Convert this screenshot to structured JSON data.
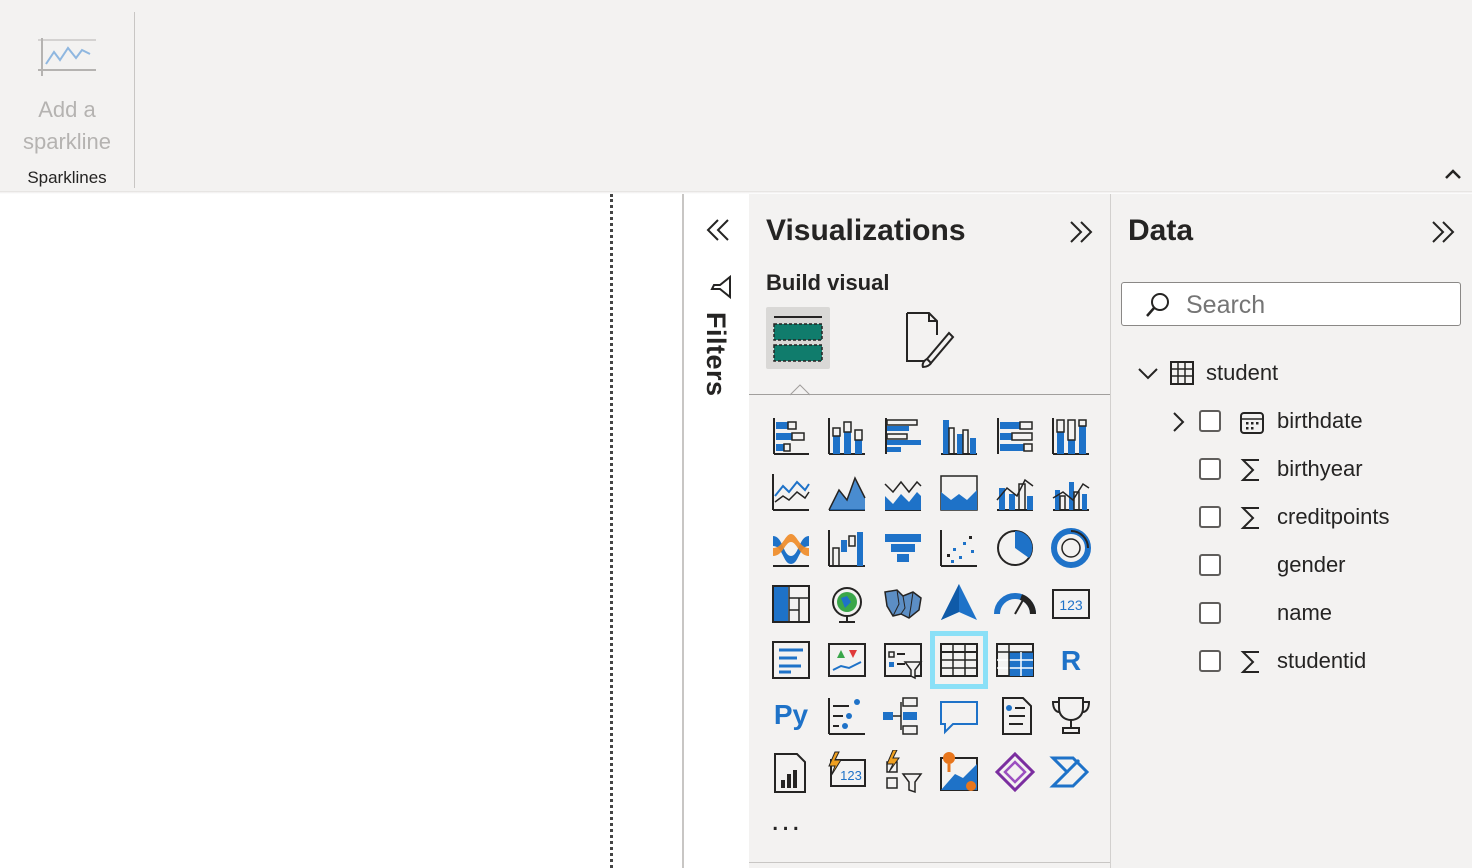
{
  "ribbon": {
    "sparkline_button": {
      "label": "Add a sparkline",
      "icon": "sparkline-icon"
    },
    "group_label": "Sparklines",
    "collapse_icon": "chevron-up-icon"
  },
  "filters": {
    "label": "Filters",
    "expand_icon": "double-chevron-left-icon",
    "icon": "funnel-icon"
  },
  "visualizations": {
    "title": "Visualizations",
    "subtitle": "Build visual",
    "collapse_icon": "double-chevron-right-icon",
    "tabs": [
      {
        "name": "build-visual",
        "icon": "fields-well-icon",
        "active": true
      },
      {
        "name": "format-visual",
        "icon": "format-paint-icon",
        "active": false
      }
    ],
    "icons": [
      [
        "stacked-bar-chart",
        "stacked-column-chart",
        "clustered-bar-chart",
        "clustered-column-chart",
        "100-stacked-bar-chart",
        "100-stacked-column-chart"
      ],
      [
        "line-chart",
        "area-chart",
        "stacked-area-chart",
        "100-stacked-area-chart",
        "line-and-stacked-column-chart",
        "line-and-clustered-column-chart"
      ],
      [
        "ribbon-chart",
        "waterfall-chart",
        "funnel-chart",
        "scatter-chart",
        "pie-chart",
        "donut-chart"
      ],
      [
        "treemap",
        "map",
        "filled-map",
        "azure-map",
        "gauge",
        "card"
      ],
      [
        "multi-row-card",
        "kpi",
        "slicer",
        "table",
        "matrix",
        "r-script-visual"
      ],
      [
        "python-visual",
        "key-influencers",
        "decomposition-tree",
        "q-and-a",
        "smart-narrative",
        "metrics"
      ],
      [
        "paginated-report",
        "power-apps",
        "power-automate",
        "arcgis-map",
        "power-apps-visual",
        "power-automate-visual"
      ]
    ],
    "selected": "table",
    "r_label": "R",
    "py_label": "Py",
    "card_label": "123",
    "more_label": "..."
  },
  "data_pane": {
    "title": "Data",
    "collapse_icon": "double-chevron-right-icon",
    "search_placeholder": "Search",
    "table": {
      "name": "student",
      "expanded": true,
      "icon": "table-icon"
    },
    "fields": [
      {
        "label": "birthdate",
        "type": "date-hierarchy",
        "expandable": true,
        "checked": false
      },
      {
        "label": "birthyear",
        "type": "sigma",
        "expandable": false,
        "checked": false
      },
      {
        "label": "creditpoints",
        "type": "sigma",
        "expandable": false,
        "checked": false
      },
      {
        "label": "gender",
        "type": "text",
        "expandable": false,
        "checked": false
      },
      {
        "label": "name",
        "type": "text",
        "expandable": false,
        "checked": false
      },
      {
        "label": "studentid",
        "type": "sigma",
        "expandable": false,
        "checked": false
      }
    ]
  }
}
